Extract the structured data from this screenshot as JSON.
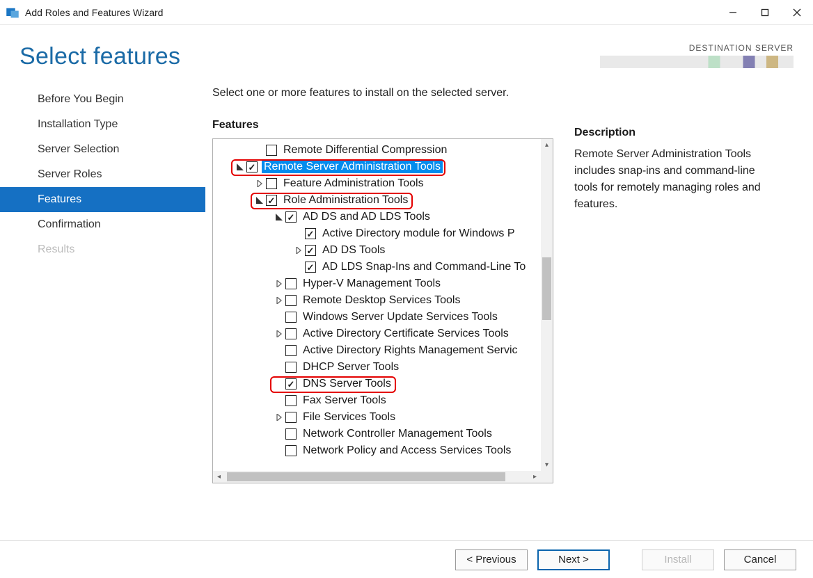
{
  "window": {
    "title": "Add Roles and Features Wizard"
  },
  "header": {
    "page_title": "Select features",
    "destination_label": "DESTINATION SERVER"
  },
  "nav": {
    "items": [
      {
        "label": "Before You Begin",
        "state": "normal"
      },
      {
        "label": "Installation Type",
        "state": "normal"
      },
      {
        "label": "Server Selection",
        "state": "normal"
      },
      {
        "label": "Server Roles",
        "state": "normal"
      },
      {
        "label": "Features",
        "state": "active"
      },
      {
        "label": "Confirmation",
        "state": "normal"
      },
      {
        "label": "Results",
        "state": "disabled"
      }
    ]
  },
  "content": {
    "instruction": "Select one or more features to install on the selected server.",
    "features_heading": "Features",
    "description_heading": "Description",
    "description_text": "Remote Server Administration Tools includes snap-ins and command-line tools for remotely managing roles and features."
  },
  "tree": [
    {
      "indent": 1,
      "expander": "none",
      "checked": false,
      "selected": false,
      "label": "Remote Differential Compression"
    },
    {
      "indent": 0,
      "expander": "expanded",
      "checked": true,
      "selected": true,
      "label": "Remote Server Administration Tools",
      "highlight": true
    },
    {
      "indent": 1,
      "expander": "collapsed",
      "checked": false,
      "selected": false,
      "label": "Feature Administration Tools"
    },
    {
      "indent": 1,
      "expander": "expanded",
      "checked": true,
      "selected": false,
      "label": "Role Administration Tools",
      "highlight": true
    },
    {
      "indent": 2,
      "expander": "expanded",
      "checked": true,
      "selected": false,
      "label": "AD DS and AD LDS Tools"
    },
    {
      "indent": 3,
      "expander": "none",
      "checked": true,
      "selected": false,
      "label": "Active Directory module for Windows P"
    },
    {
      "indent": 3,
      "expander": "collapsed",
      "checked": true,
      "selected": false,
      "label": "AD DS Tools"
    },
    {
      "indent": 3,
      "expander": "none",
      "checked": true,
      "selected": false,
      "label": "AD LDS Snap-Ins and Command-Line To"
    },
    {
      "indent": 2,
      "expander": "collapsed",
      "checked": false,
      "selected": false,
      "label": "Hyper-V Management Tools"
    },
    {
      "indent": 2,
      "expander": "collapsed",
      "checked": false,
      "selected": false,
      "label": "Remote Desktop Services Tools"
    },
    {
      "indent": 2,
      "expander": "none",
      "checked": false,
      "selected": false,
      "label": "Windows Server Update Services Tools"
    },
    {
      "indent": 2,
      "expander": "collapsed",
      "checked": false,
      "selected": false,
      "label": "Active Directory Certificate Services Tools"
    },
    {
      "indent": 2,
      "expander": "none",
      "checked": false,
      "selected": false,
      "label": "Active Directory Rights Management Servic"
    },
    {
      "indent": 2,
      "expander": "none",
      "checked": false,
      "selected": false,
      "label": "DHCP Server Tools"
    },
    {
      "indent": 2,
      "expander": "none",
      "checked": true,
      "selected": false,
      "label": "DNS Server Tools",
      "highlight": true
    },
    {
      "indent": 2,
      "expander": "none",
      "checked": false,
      "selected": false,
      "label": "Fax Server Tools"
    },
    {
      "indent": 2,
      "expander": "collapsed",
      "checked": false,
      "selected": false,
      "label": "File Services Tools"
    },
    {
      "indent": 2,
      "expander": "none",
      "checked": false,
      "selected": false,
      "label": "Network Controller Management Tools"
    },
    {
      "indent": 2,
      "expander": "none",
      "checked": false,
      "selected": false,
      "label": "Network Policy and Access Services Tools"
    }
  ],
  "footer": {
    "previous": "< Previous",
    "next": "Next >",
    "install": "Install",
    "cancel": "Cancel"
  }
}
